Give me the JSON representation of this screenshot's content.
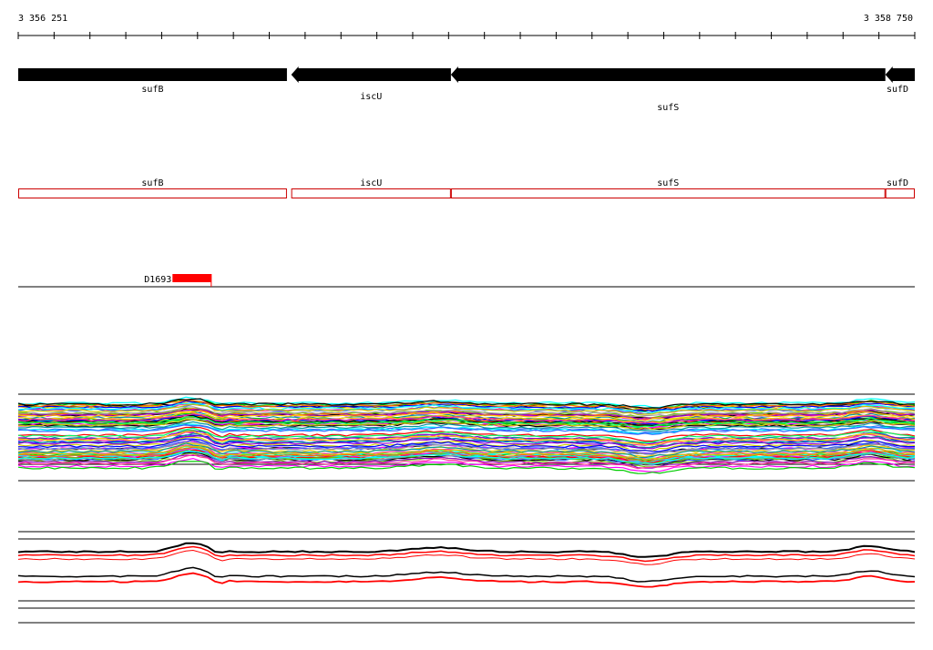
{
  "coordinates": {
    "start_label": "3 356 251",
    "end_label": "3 358 750",
    "start": 3356251,
    "end": 3358750
  },
  "genes": [
    {
      "name": "sufB",
      "start": 3356251,
      "end": 3357000,
      "strand": "+"
    },
    {
      "name": "iscU",
      "start": 3357012,
      "end": 3357457,
      "strand": "-"
    },
    {
      "name": "sufS",
      "start": 3357457,
      "end": 3358668,
      "strand": "-"
    },
    {
      "name": "sufD",
      "start": 3358668,
      "end": 3358750,
      "strand": "-"
    }
  ],
  "feature": {
    "name": "D1693",
    "start": 3356681,
    "end": 3356789
  },
  "colors": {
    "gene": "#000000",
    "annotation_box": "#cc0000",
    "feature": "#ff0000",
    "baseline": "#000000"
  },
  "tracks": {
    "multi_profile_colors": [
      "#ff00ff",
      "#00cc00",
      "#00ffff",
      "#ffcc00",
      "#0000ff",
      "#ff6600",
      "#009999",
      "#cccc00",
      "#9900cc",
      "#00ff66",
      "#ff3399",
      "#3366ff",
      "#999999",
      "#66cc00"
    ]
  }
}
